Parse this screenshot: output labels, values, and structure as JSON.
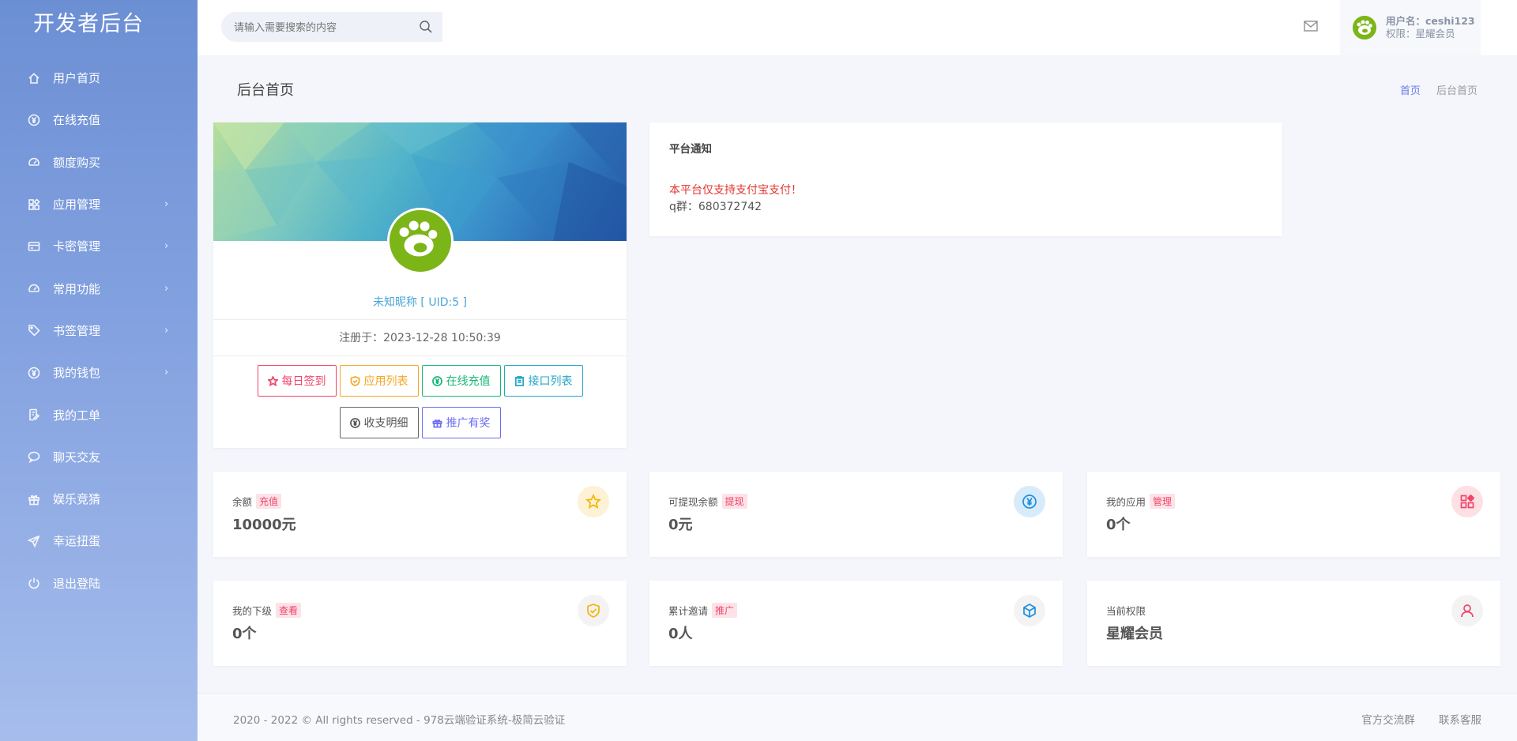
{
  "brand": "开发者后台",
  "nav": [
    {
      "label": "用户首页",
      "icon": "home-icon",
      "arrow": ""
    },
    {
      "label": "在线充值",
      "icon": "yen-circle-icon",
      "arrow": ""
    },
    {
      "label": "额度购买",
      "icon": "gauge-icon",
      "arrow": ""
    },
    {
      "label": "应用管理",
      "icon": "apps-icon",
      "arrow": "›"
    },
    {
      "label": "卡密管理",
      "icon": "card-icon",
      "arrow": "›"
    },
    {
      "label": "常用功能",
      "icon": "gauge-icon",
      "arrow": "›"
    },
    {
      "label": "书签管理",
      "icon": "tag-icon",
      "arrow": "›"
    },
    {
      "label": "我的钱包",
      "icon": "yen-circle-icon",
      "arrow": "›"
    },
    {
      "label": "我的工单",
      "icon": "ticket-icon",
      "arrow": ""
    },
    {
      "label": "聊天交友",
      "icon": "chat-icon",
      "arrow": ""
    },
    {
      "label": "娱乐竞猜",
      "icon": "gift-icon",
      "arrow": ""
    },
    {
      "label": "幸运扭蛋",
      "icon": "send-icon",
      "arrow": ""
    },
    {
      "label": "退出登陆",
      "icon": "power-icon",
      "arrow": ""
    }
  ],
  "header": {
    "search_placeholder": "请输入需要搜索的内容",
    "user_line1": "用户名：ceshi123",
    "user_line2": "权限：星耀会员"
  },
  "page": {
    "title": "后台首页",
    "breadcrumb": [
      "首页",
      "后台首页"
    ]
  },
  "profile": {
    "nickname": "未知昵称 [ UID:5 ]",
    "registered": "注册于：2023-12-28 10:50:39",
    "buttons": [
      {
        "label": "每日签到",
        "icon": "star-icon"
      },
      {
        "label": "应用列表",
        "icon": "shield-icon"
      },
      {
        "label": "在线充值",
        "icon": "yen-circle-icon"
      },
      {
        "label": "接口列表",
        "icon": "clipboard-icon"
      },
      {
        "label": "收支明细",
        "icon": "yen-circle-icon"
      },
      {
        "label": "推广有奖",
        "icon": "gift-icon"
      }
    ]
  },
  "notice": {
    "title": "平台通知",
    "line1": "本平台仅支持支付宝支付！",
    "line2": "q群：680372742"
  },
  "stats": [
    {
      "label": "余额",
      "tag": "充值",
      "value": "10000元",
      "icon": "star-icon",
      "bg": "#fdf2d6",
      "color": "#f5b400"
    },
    {
      "label": "可提现余额",
      "tag": "提现",
      "value": "0元",
      "icon": "yen-circle-icon",
      "bg": "#d7ebfb",
      "color": "#1e8fe0"
    },
    {
      "label": "我的应用",
      "tag": "管理",
      "value": "0个",
      "icon": "apps-icon",
      "bg": "#fde0e3",
      "color": "#f0446b"
    },
    {
      "label": "我的下级",
      "tag": "查看",
      "value": "0个",
      "icon": "shield-check-icon",
      "bg": "#f3f3f3",
      "color": "#f5b400"
    },
    {
      "label": "累计邀请",
      "tag": "推广",
      "value": "0人",
      "icon": "cube-icon",
      "bg": "#f3f3f3",
      "color": "#1e8fe0"
    },
    {
      "label": "当前权限",
      "tag": "",
      "value": "星耀会员",
      "icon": "user-icon",
      "bg": "#f3f3f3",
      "color": "#f0446b"
    }
  ],
  "footer": {
    "copyright": "2020 - 2022 © All rights reserved - 978云端验证系统-极简云验证",
    "links": [
      "官方交流群",
      "联系客服"
    ]
  }
}
